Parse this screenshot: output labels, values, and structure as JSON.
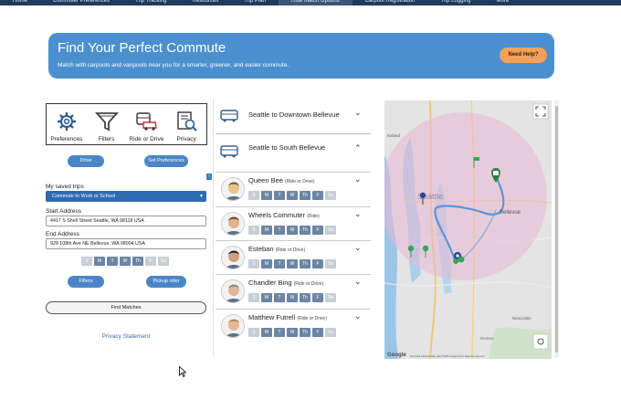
{
  "nav": {
    "items": [
      "Home",
      "Commuter Preferences",
      "Trip Tracking",
      "Resources",
      "Trip Plan",
      "Ride Match Options",
      "Carpool Registration",
      "Trip Logging",
      "More"
    ]
  },
  "hero": {
    "title": "Find Your Perfect Commute",
    "subtitle": "Match with carpools and vanpools near you for a smarter, greener, and easier commute.",
    "help": "Need Help?"
  },
  "toolbar": {
    "items": [
      {
        "label": "Preferences",
        "icon": "gear-icon"
      },
      {
        "label": "Filters",
        "icon": "funnel-icon"
      },
      {
        "label": "Ride or Drive",
        "icon": "bus-car-icon"
      },
      {
        "label": "Privacy",
        "icon": "privacy-document-icon"
      }
    ]
  },
  "form": {
    "drive_btn": "Drive",
    "set_pref_btn": "Set Preferences",
    "saved_trips_label": "My saved trips",
    "saved_trip_value": "Commute to Work or School",
    "start_label": "Start Address",
    "start_value": "4417 S Shell Street Seattle, WA 98118 USA",
    "end_label": "End Address",
    "end_value": "929 108th Ave NE Bellevue, WA 98004 USA",
    "filters_btn": "Filters",
    "pickup_btn": "Pickup rider",
    "find_btn": "Find Matches",
    "privacy_link": "Privacy Statement"
  },
  "days": [
    "S",
    "M",
    "T",
    "W",
    "Th",
    "F",
    "Sa"
  ],
  "form_days_on": [
    false,
    true,
    true,
    true,
    true,
    false,
    false
  ],
  "routes": [
    {
      "title": "Seattle to Downtown Bellevue",
      "chevron": "⌄"
    },
    {
      "title": "Seattle to South Bellevue",
      "chevron": "⌃"
    }
  ],
  "matches": [
    {
      "name": "Queen Bee",
      "role": "(Ride or Drive)",
      "days_on": [
        false,
        true,
        true,
        true,
        true,
        true,
        false
      ]
    },
    {
      "name": "Wheels Commuter",
      "role": "(Ride)",
      "days_on": [
        false,
        true,
        true,
        true,
        true,
        true,
        false
      ]
    },
    {
      "name": "Esteban",
      "role": "(Ride or Drive)",
      "days_on": [
        false,
        true,
        true,
        true,
        true,
        true,
        false
      ]
    },
    {
      "name": "Chandler Bing",
      "role": "(Ride or Drive)",
      "days_on": [
        false,
        true,
        true,
        true,
        true,
        true,
        false
      ]
    },
    {
      "name": "Matthew Futrell",
      "role": "(Ride or Drive)",
      "days_on": [
        false,
        true,
        true,
        true,
        true,
        true,
        false
      ]
    }
  ],
  "map": {
    "labels": [
      "Ballard",
      "Seattle",
      "Bellevue",
      "Newcastle",
      "Renton"
    ],
    "footer": "Google",
    "attribution": "Keyboard shortcuts   Map data ©2025 Google   Terms   Report a map error"
  },
  "colors": {
    "hero": "#4a90cf",
    "accent": "#4a86c7",
    "help": "#f4a15a",
    "route_line": "#5b95d8",
    "radius_fill": "#e8b8d4"
  }
}
